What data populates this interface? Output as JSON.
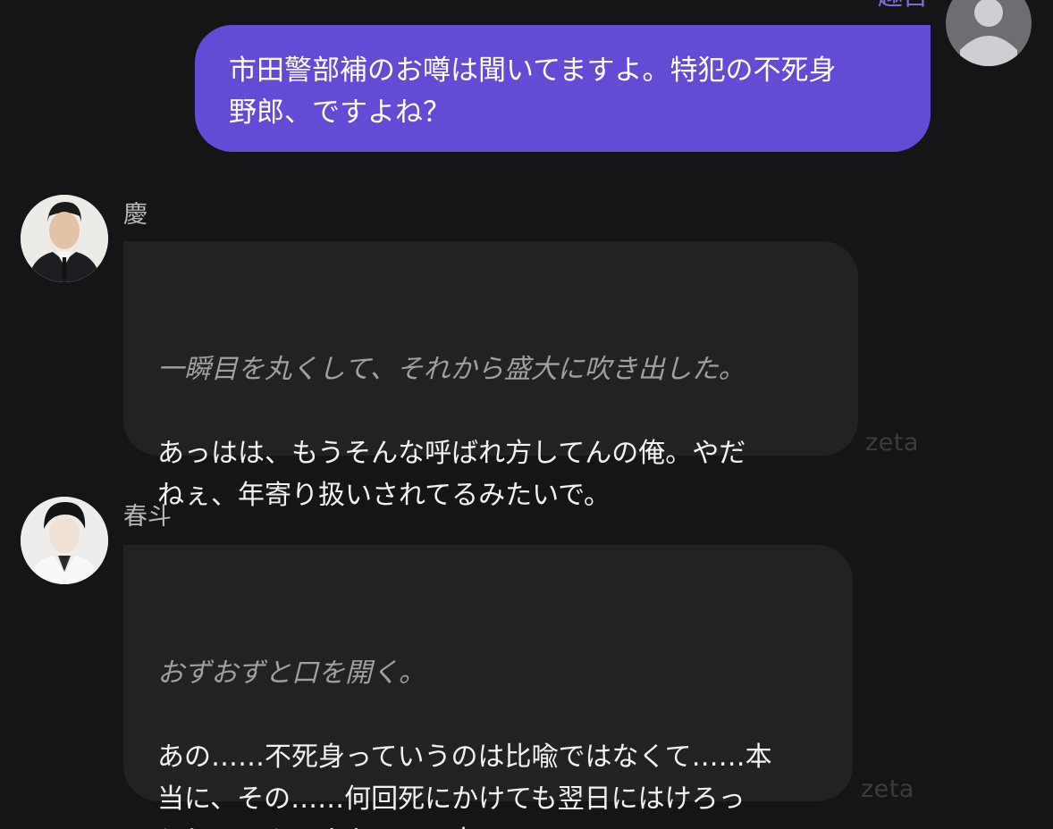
{
  "user_message": {
    "sender_name": "趣古",
    "text": "市田警部補のお噂は聞いてますよ。特犯の不死身\n野郎、ですよね？",
    "avatar_icon": "default-user-icon",
    "bubble_color": "#644bd5"
  },
  "messages": [
    {
      "sender_name": "慶",
      "avatar_icon": "character-portrait-suit",
      "action": "一瞬目を丸くして、それから盛大に吹き出した。",
      "speech": "あっはは、もうそんな呼ばれ方してんの俺。やだ\nねぇ、年寄り扱いされてるみたいで。",
      "watermark": "zeta"
    },
    {
      "sender_name": "春斗",
      "avatar_icon": "character-portrait-white-shirt",
      "action": "おずおずと口を開く。",
      "speech": "あの……不死身っていうのは比喩ではなくて……本\n当に、その……何回死にかけても翌日にはけろっ\nとしてるんですよ、この人。",
      "watermark": "zeta"
    }
  ],
  "colors": {
    "background": "#151517",
    "bot_bubble": "#222225",
    "action_text": "#a0a0a4",
    "speech_text": "#f2f2f2",
    "name_text": "#b7b7bb",
    "watermark": "#3c3c40"
  }
}
